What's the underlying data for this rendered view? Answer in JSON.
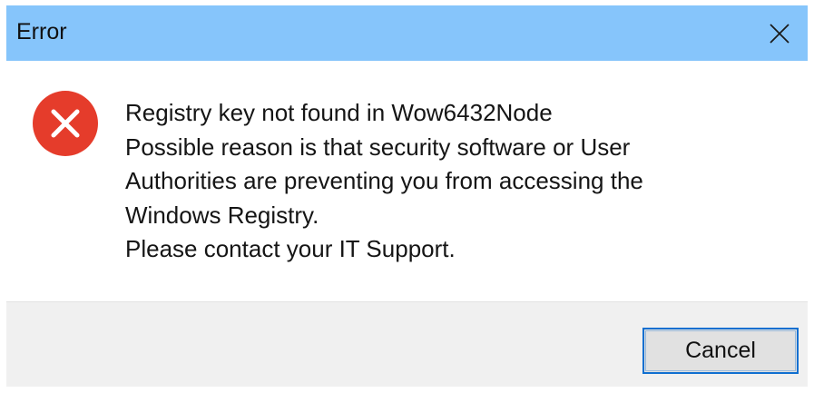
{
  "window": {
    "title": "Error",
    "titlebar_color": "#86c5fb"
  },
  "icons": {
    "close": "close-icon",
    "error": "error-icon",
    "error_color": "#e53c2b"
  },
  "message": {
    "lines": [
      "Registry key not found in Wow6432Node",
      "Possible reason is that security software or User",
      "Authorities are preventing you from accessing the",
      "Windows Registry.",
      "Please contact your IT Support."
    ]
  },
  "buttons": {
    "cancel_label": "Cancel",
    "focus_color": "#0f6fd0"
  }
}
